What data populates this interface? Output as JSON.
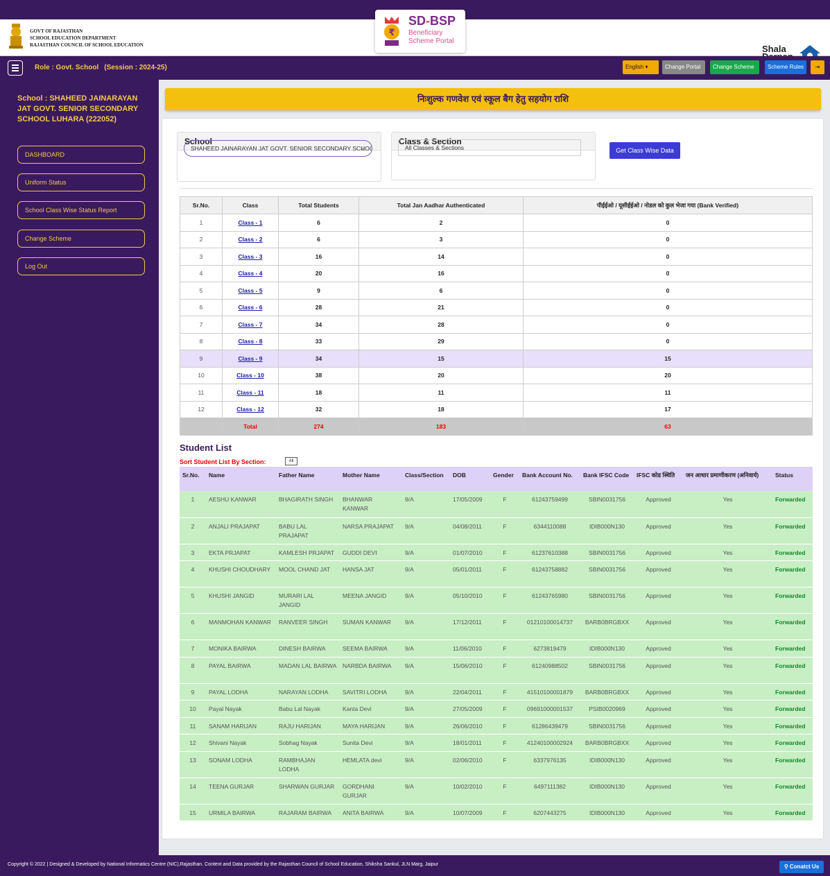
{
  "header": {
    "gov_line1": "GOVT OF RAJASTHAN",
    "gov_line2": "SCHOOL EDUCATION DEPARTMENT",
    "gov_line3": "RAJASTHAN COUNCIL OF SCHOOL EDUCATION",
    "portal_title_a": "SD",
    "portal_title_dash": "-",
    "portal_title_b": "BSP",
    "portal_sub1": "Beneficiary",
    "portal_sub2": "Scheme Portal",
    "shala_line1": "Shala",
    "shala_line2": "Darpan"
  },
  "navbar": {
    "role": "Role : Govt. School",
    "session": "(Session : 2024-25)",
    "language": "English",
    "change_portal": "Change Portal",
    "change_scheme": "Change Scheme",
    "scheme_rules": "Scheme Rules"
  },
  "sidebar": {
    "school_name": "School : SHAHEED JAINARAYAN JAT GOVT. SENIOR SECONDARY SCHOOL LUHARA (222052)",
    "items": [
      {
        "label": "DASHBOARD"
      },
      {
        "label": "Uniform Status"
      },
      {
        "label": "School Class Wise Status Report"
      },
      {
        "label": "Change Scheme"
      },
      {
        "label": "Log Out"
      }
    ]
  },
  "main": {
    "banner": "निःशुल्क गणवेश एवं स्कूल बैग हेतु सहयोग राशि",
    "school_card_title": "School",
    "school_value": "SHAHEED JAINARAYAN JAT GOVT. SENIOR SECONDARY SCHOOL",
    "class_card_title": "Class & Section",
    "class_value": "All Classes & Sections",
    "get_button": "Get Class Wise Data"
  },
  "summary": {
    "headers": [
      "Sr.No.",
      "Class",
      "Total Students",
      "Total Jan Aadhar Authenticated",
      "पीईईओ / यूसीईईओ / नोडल को कुल भेजा गया (Bank Verified)"
    ],
    "rows": [
      {
        "sr": "1",
        "class": "Class - 1",
        "total": "6",
        "auth": "2",
        "sent": "0"
      },
      {
        "sr": "2",
        "class": "Class - 2",
        "total": "6",
        "auth": "3",
        "sent": "0"
      },
      {
        "sr": "3",
        "class": "Class - 3",
        "total": "16",
        "auth": "14",
        "sent": "0"
      },
      {
        "sr": "4",
        "class": "Class - 4",
        "total": "20",
        "auth": "16",
        "sent": "0"
      },
      {
        "sr": "5",
        "class": "Class - 5",
        "total": "9",
        "auth": "6",
        "sent": "0"
      },
      {
        "sr": "6",
        "class": "Class - 6",
        "total": "28",
        "auth": "21",
        "sent": "0"
      },
      {
        "sr": "7",
        "class": "Class - 7",
        "total": "34",
        "auth": "28",
        "sent": "0"
      },
      {
        "sr": "8",
        "class": "Class - 8",
        "total": "33",
        "auth": "29",
        "sent": "0"
      },
      {
        "sr": "9",
        "class": "Class - 9",
        "total": "34",
        "auth": "15",
        "sent": "15"
      },
      {
        "sr": "10",
        "class": "Class - 10",
        "total": "38",
        "auth": "20",
        "sent": "20"
      },
      {
        "sr": "11",
        "class": "Class - 11",
        "total": "18",
        "auth": "11",
        "sent": "11"
      },
      {
        "sr": "12",
        "class": "Class - 12",
        "total": "32",
        "auth": "18",
        "sent": "17"
      }
    ],
    "total_label": "Total",
    "total_students": "274",
    "total_auth": "183",
    "total_sent": "63"
  },
  "students": {
    "title": "Student List",
    "sort_label": "Sort Student List By Section:",
    "all_button": "All",
    "headers": [
      "Sr.No.",
      "Name",
      "Father Name",
      "Mother Name",
      "Class/Section",
      "DOB",
      "Gender",
      "Bank Account No.",
      "Bank IFSC Code",
      "IFSC कोड स्थिति",
      "जन आधार प्रमाणीकरण (अनिवार्य)",
      "Status"
    ],
    "rows": [
      {
        "sr": "1",
        "name": "AESHU KANWAR",
        "father": "BHAGIRATH SINGH",
        "mother": "BHANWAR KANWAR",
        "cls": "9/A",
        "dob": "17/05/2009",
        "gender": "F",
        "account": "61243759499",
        "ifsc": "SBIN0031756",
        "ifsc_status": "Approved",
        "aadhar": "Yes",
        "status": "Forwarded"
      },
      {
        "sr": "2",
        "name": "ANJALI PRAJAPAT",
        "father": "BABU LAL PRAJAPAT",
        "mother": "NARSA PRAJAPAT",
        "cls": "9/A",
        "dob": "04/08/2011",
        "gender": "F",
        "account": "6344110088",
        "ifsc": "IDIB000N130",
        "ifsc_status": "Approved",
        "aadhar": "Yes",
        "status": "Forwarded"
      },
      {
        "sr": "3",
        "name": "EKTA PRJAPAT",
        "father": "KAMLESH PRJAPAT",
        "mother": "GUDDI DEVI",
        "cls": "9/A",
        "dob": "01/07/2010",
        "gender": "F",
        "account": "61237610388",
        "ifsc": "SBIN0031756",
        "ifsc_status": "Approved",
        "aadhar": "Yes",
        "status": "Forwarded"
      },
      {
        "sr": "4",
        "name": "KHUSHI CHOUDHARY",
        "father": "MOOL CHAND JAT",
        "mother": "HANSA JAT",
        "cls": "9/A",
        "dob": "05/01/2011",
        "gender": "F",
        "account": "61243758882",
        "ifsc": "SBIN0031756",
        "ifsc_status": "Approved",
        "aadhar": "Yes",
        "status": "Forwarded"
      },
      {
        "sr": "5",
        "name": "KHUSHI JANGID",
        "father": "MURARI LAL JANGID",
        "mother": "MEENA JANGID",
        "cls": "9/A",
        "dob": "05/10/2010",
        "gender": "F",
        "account": "61243765980",
        "ifsc": "SBIN0031756",
        "ifsc_status": "Approved",
        "aadhar": "Yes",
        "status": "Forwarded"
      },
      {
        "sr": "6",
        "name": "MANMOHAN KANWAR",
        "father": "RANVEER SINGH",
        "mother": "SUMAN KANWAR",
        "cls": "9/A",
        "dob": "17/12/2011",
        "gender": "F",
        "account": "01210100014737",
        "ifsc": "BARB0BRGBXX",
        "ifsc_status": "Approved",
        "aadhar": "Yes",
        "status": "Forwarded"
      },
      {
        "sr": "7",
        "name": "MONIKA BAIRWA",
        "father": "DINESH BAIRWA",
        "mother": "SEEMA BAIRWA",
        "cls": "9/A",
        "dob": "11/06/2010",
        "gender": "F",
        "account": "6273819479",
        "ifsc": "IDIB000N130",
        "ifsc_status": "Approved",
        "aadhar": "Yes",
        "status": "Forwarded"
      },
      {
        "sr": "8",
        "name": "PAYAL BAIRWA",
        "father": "MADAN LAL BAIRWA",
        "mother": "NARBDA BAIRWA",
        "cls": "9/A",
        "dob": "15/06/2010",
        "gender": "F",
        "account": "61240988502",
        "ifsc": "SBIN0031756",
        "ifsc_status": "Approved",
        "aadhar": "Yes",
        "status": "Forwarded"
      },
      {
        "sr": "9",
        "name": "PAYAL LODHA",
        "father": "NARAYAN LODHA",
        "mother": "SAVITRI LODHA",
        "cls": "9/A",
        "dob": "22/04/2011",
        "gender": "F",
        "account": "41510100001879",
        "ifsc": "BARB0BRGBXX",
        "ifsc_status": "Approved",
        "aadhar": "Yes",
        "status": "Forwarded"
      },
      {
        "sr": "10",
        "name": "Payal Nayak",
        "father": "Babu Lal Nayak",
        "mother": "Kanta Devi",
        "cls": "9/A",
        "dob": "27/05/2009",
        "gender": "F",
        "account": "09691000001537",
        "ifsc": "PSIB0020969",
        "ifsc_status": "Approved",
        "aadhar": "Yes",
        "status": "Forwarded"
      },
      {
        "sr": "11",
        "name": "SANAM HARIJAN",
        "father": "RAJU HARIJAN",
        "mother": "MAYA HARIJAN",
        "cls": "9/A",
        "dob": "26/06/2010",
        "gender": "F",
        "account": "61286439479",
        "ifsc": "SBIN0031756",
        "ifsc_status": "Approved",
        "aadhar": "Yes",
        "status": "Forwarded"
      },
      {
        "sr": "12",
        "name": "Shivani Nayak",
        "father": "Sobhag Nayak",
        "mother": "Sunita Devi",
        "cls": "9/A",
        "dob": "18/01/2011",
        "gender": "F",
        "account": "41240100002924",
        "ifsc": "BARB0BRGBXX",
        "ifsc_status": "Approved",
        "aadhar": "Yes",
        "status": "Forwarded"
      },
      {
        "sr": "13",
        "name": "SONAM LODHA",
        "father": "RAMBHAJAN LODHA",
        "mother": "HEMLATA devi",
        "cls": "9/A",
        "dob": "02/06/2010",
        "gender": "F",
        "account": "6337976135",
        "ifsc": "IDIB000N130",
        "ifsc_status": "Approved",
        "aadhar": "Yes",
        "status": "Forwarded"
      },
      {
        "sr": "14",
        "name": "TEENA GURJAR",
        "father": "SHARWAN GURJAR",
        "mother": "GORDHANI GURJAR",
        "cls": "9/A",
        "dob": "10/02/2010",
        "gender": "F",
        "account": "6497111382",
        "ifsc": "IDIB000N130",
        "ifsc_status": "Approved",
        "aadhar": "Yes",
        "status": "Forwarded"
      },
      {
        "sr": "15",
        "name": "URMILA BAIRWA",
        "father": "RAJARAM BAIRWA",
        "mother": "ANITA BAIRWA",
        "cls": "9/A",
        "dob": "10/07/2009",
        "gender": "F",
        "account": "6207443275",
        "ifsc": "IDIB000N130",
        "ifsc_status": "Approved",
        "aadhar": "Yes",
        "status": "Forwarded"
      }
    ]
  },
  "footer": {
    "text": "Copyright © 2022 | Designed & Developed by National Informatics Centre (NIC),Rajasthan. Content and Data provided by the Rajasthan Council of School Education, Shiksha Sankul, JLN Marg, Jaipur",
    "contact": "Conatct Us"
  },
  "colors": {
    "brand_purple": "#3a1a5e",
    "accent_yellow": "#f2c00d",
    "row_green": "#c8eec4",
    "forwarded_green": "#0a8a2a"
  }
}
